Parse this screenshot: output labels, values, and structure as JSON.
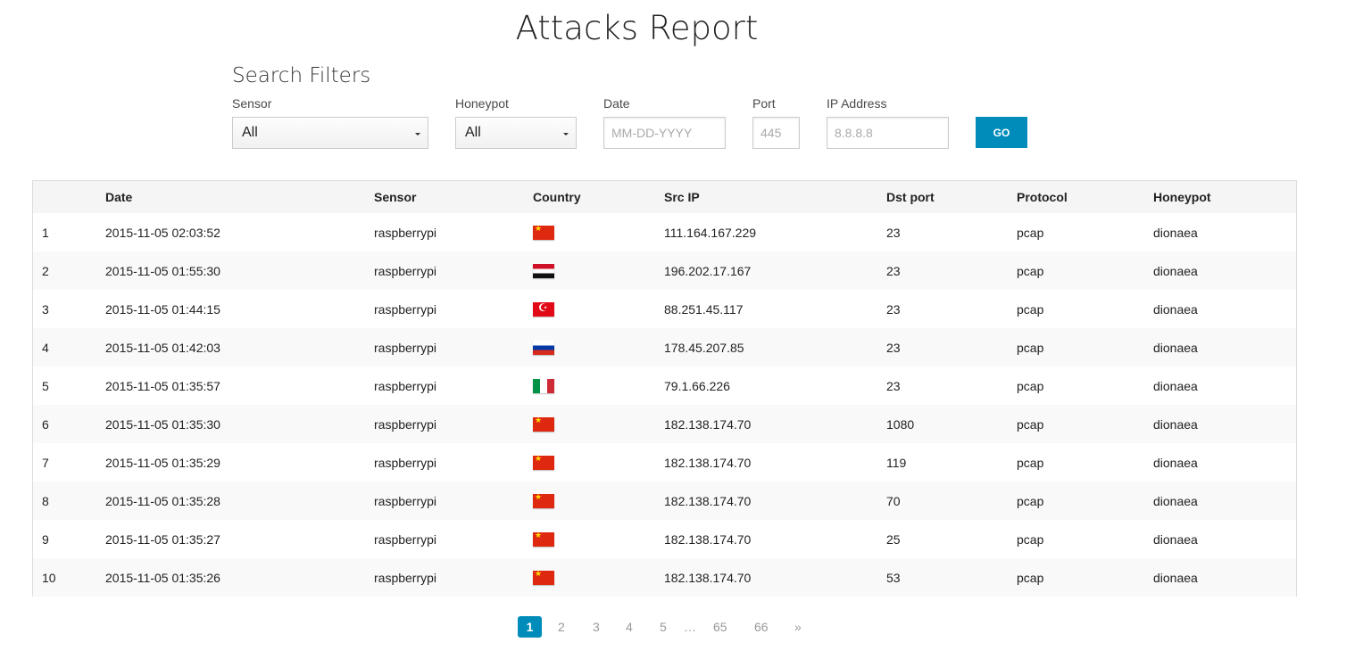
{
  "page": {
    "title": "Attacks Report"
  },
  "filters": {
    "title": "Search Filters",
    "sensor": {
      "label": "Sensor",
      "value": "All"
    },
    "honeypot": {
      "label": "Honeypot",
      "value": "All"
    },
    "date": {
      "label": "Date",
      "placeholder": "MM-DD-YYYY"
    },
    "port": {
      "label": "Port",
      "placeholder": "445"
    },
    "ip": {
      "label": "IP Address",
      "placeholder": "8.8.8.8"
    },
    "go_label": "GO"
  },
  "table": {
    "headers": [
      "",
      "Date",
      "Sensor",
      "Country",
      "Src IP",
      "Dst port",
      "Protocol",
      "Honeypot"
    ],
    "rows": [
      {
        "n": "1",
        "date": "2015-11-05 02:03:52",
        "sensor": "raspberrypi",
        "flag": "cn",
        "src": "111.164.167.229",
        "port": "23",
        "protocol": "pcap",
        "honeypot": "dionaea"
      },
      {
        "n": "2",
        "date": "2015-11-05 01:55:30",
        "sensor": "raspberrypi",
        "flag": "eg",
        "src": "196.202.17.167",
        "port": "23",
        "protocol": "pcap",
        "honeypot": "dionaea"
      },
      {
        "n": "3",
        "date": "2015-11-05 01:44:15",
        "sensor": "raspberrypi",
        "flag": "tr",
        "src": "88.251.45.117",
        "port": "23",
        "protocol": "pcap",
        "honeypot": "dionaea"
      },
      {
        "n": "4",
        "date": "2015-11-05 01:42:03",
        "sensor": "raspberrypi",
        "flag": "ru",
        "src": "178.45.207.85",
        "port": "23",
        "protocol": "pcap",
        "honeypot": "dionaea"
      },
      {
        "n": "5",
        "date": "2015-11-05 01:35:57",
        "sensor": "raspberrypi",
        "flag": "it",
        "src": "79.1.66.226",
        "port": "23",
        "protocol": "pcap",
        "honeypot": "dionaea"
      },
      {
        "n": "6",
        "date": "2015-11-05 01:35:30",
        "sensor": "raspberrypi",
        "flag": "cn",
        "src": "182.138.174.70",
        "port": "1080",
        "protocol": "pcap",
        "honeypot": "dionaea"
      },
      {
        "n": "7",
        "date": "2015-11-05 01:35:29",
        "sensor": "raspberrypi",
        "flag": "cn",
        "src": "182.138.174.70",
        "port": "119",
        "protocol": "pcap",
        "honeypot": "dionaea"
      },
      {
        "n": "8",
        "date": "2015-11-05 01:35:28",
        "sensor": "raspberrypi",
        "flag": "cn",
        "src": "182.138.174.70",
        "port": "70",
        "protocol": "pcap",
        "honeypot": "dionaea"
      },
      {
        "n": "9",
        "date": "2015-11-05 01:35:27",
        "sensor": "raspberrypi",
        "flag": "cn",
        "src": "182.138.174.70",
        "port": "25",
        "protocol": "pcap",
        "honeypot": "dionaea"
      },
      {
        "n": "10",
        "date": "2015-11-05 01:35:26",
        "sensor": "raspberrypi",
        "flag": "cn",
        "src": "182.138.174.70",
        "port": "53",
        "protocol": "pcap",
        "honeypot": "dionaea"
      }
    ]
  },
  "pagination": {
    "current": "1",
    "pages": [
      "2",
      "3",
      "4",
      "5"
    ],
    "ellipsis": "…",
    "last_pages": [
      "65",
      "66"
    ],
    "next": "»"
  },
  "colors": {
    "accent": "#008cba"
  }
}
